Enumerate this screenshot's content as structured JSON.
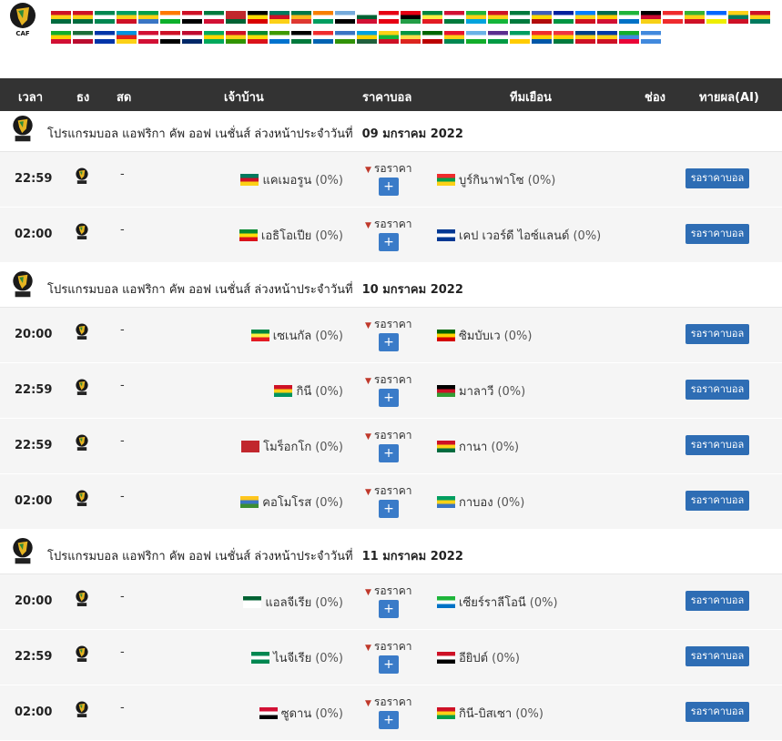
{
  "header": {
    "time": "เวลา",
    "flag": "ธง",
    "live": "สด",
    "home": "เจ้าบ้าน",
    "price": "ราคาบอล",
    "away": "ทีมเยือน",
    "channel": "ช่อง",
    "predict": "ทายผล(AI)"
  },
  "logo_text": "CAF",
  "flag_icons": [
    {
      "colors": [
        "#ce1126",
        "#fcd116",
        "#006b3f"
      ]
    },
    {
      "colors": [
        "#ce1126",
        "#fcd116",
        "#006b3f"
      ]
    },
    {
      "colors": [
        "#008751",
        "#fff",
        "#008751"
      ]
    },
    {
      "colors": [
        "#009e60",
        "#fcd116",
        "#ce1126"
      ]
    },
    {
      "colors": [
        "#009e49",
        "#fcd116",
        "#3a75c4"
      ]
    },
    {
      "colors": [
        "#ff7900",
        "#fff",
        "#0db02b"
      ]
    },
    {
      "colors": [
        "#ce1126",
        "#fff",
        "#000"
      ]
    },
    {
      "colors": [
        "#007a3d",
        "#fff",
        "#d21034"
      ]
    },
    {
      "colors": [
        "#c1272d",
        "#c1272d",
        "#006233"
      ]
    },
    {
      "colors": [
        "#000",
        "#fcdc04",
        "#d90000"
      ]
    },
    {
      "colors": [
        "#007a5e",
        "#ce1126",
        "#fcd116"
      ]
    },
    {
      "colors": [
        "#007749",
        "#ffb81c",
        "#de3831"
      ]
    },
    {
      "colors": [
        "#f77f00",
        "#fff",
        "#009e60"
      ]
    },
    {
      "colors": [
        "#75aadb",
        "#fff",
        "#000"
      ]
    },
    {
      "colors": [
        "#fff",
        "#006233",
        "#d21034"
      ]
    },
    {
      "colors": [
        "#e70013",
        "#fff",
        "#e70013"
      ]
    },
    {
      "colors": [
        "#e70013",
        "#000",
        "#239e46"
      ]
    },
    {
      "colors": [
        "#00853f",
        "#fdef42",
        "#e31b23"
      ]
    },
    {
      "colors": [
        "#d21034",
        "#fff",
        "#007a3d"
      ]
    },
    {
      "colors": [
        "#1eb53a",
        "#fcd116",
        "#00a3dd"
      ]
    },
    {
      "colors": [
        "#ce1126",
        "#fcd116",
        "#14b53a"
      ]
    },
    {
      "colors": [
        "#007a3d",
        "#fff",
        "#007a3d"
      ]
    },
    {
      "colors": [
        "#3e5eb9",
        "#ffd900",
        "#b10c0c"
      ]
    },
    {
      "colors": [
        "#00209f",
        "#fff",
        "#009543"
      ]
    },
    {
      "colors": [
        "#007fff",
        "#f7d618",
        "#ce1021"
      ]
    },
    {
      "colors": [
        "#006a4e",
        "#ffce00",
        "#d21034"
      ]
    },
    {
      "colors": [
        "#1eb53a",
        "#fff",
        "#0072c6"
      ]
    },
    {
      "colors": [
        "#000",
        "#cc092f",
        "#f7d116"
      ]
    },
    {
      "colors": [
        "#ef2b2d",
        "#fff",
        "#ef2b2d"
      ]
    },
    {
      "colors": [
        "#34b233",
        "#fcd116",
        "#ce1126"
      ]
    },
    {
      "colors": [
        "#0066ff",
        "#fff",
        "#eeee00"
      ]
    },
    {
      "colors": [
        "#fcd116",
        "#007a5e",
        "#ce1126"
      ]
    },
    {
      "colors": [
        "#ce1126",
        "#fcd116",
        "#007a5e"
      ]
    },
    {
      "colors": [
        "#12ad2b",
        "#ffd100",
        "#d21034"
      ]
    },
    {
      "colors": [
        "#1c6d38",
        "#fff",
        "#ba0c2f"
      ]
    },
    {
      "colors": [
        "#0035a9",
        "#fff",
        "#0035a9"
      ]
    },
    {
      "colors": [
        "#0093dd",
        "#e32118",
        "#fcd116"
      ]
    },
    {
      "colors": [
        "#d21034",
        "#fff",
        "#d21034"
      ]
    },
    {
      "colors": [
        "#ce1126",
        "#fff",
        "#000"
      ]
    },
    {
      "colors": [
        "#bf0a30",
        "#fff",
        "#002868"
      ]
    },
    {
      "colors": [
        "#00a95c",
        "#ffd700",
        "#00a95c"
      ]
    },
    {
      "colors": [
        "#ce1126",
        "#fcd116",
        "#319400"
      ]
    },
    {
      "colors": [
        "#078930",
        "#fcdd09",
        "#da121a"
      ]
    },
    {
      "colors": [
        "#3e9a00",
        "#fff",
        "#0073ce"
      ]
    },
    {
      "colors": [
        "#000",
        "#fff",
        "#007a3d"
      ]
    },
    {
      "colors": [
        "#ef2b2d",
        "#fff",
        "#0063b2"
      ]
    },
    {
      "colors": [
        "#3a75c4",
        "#fff",
        "#319208"
      ]
    },
    {
      "colors": [
        "#00a1de",
        "#fad201",
        "#20603d"
      ]
    },
    {
      "colors": [
        "#fcd116",
        "#14b53a",
        "#ce1126"
      ]
    },
    {
      "colors": [
        "#009543",
        "#fbde4a",
        "#dc241f"
      ]
    },
    {
      "colors": [
        "#006600",
        "#ffffff",
        "#bb0000"
      ]
    },
    {
      "colors": [
        "#e8112d",
        "#fcd116",
        "#008751"
      ]
    },
    {
      "colors": [
        "#6ab2e7",
        "#fff",
        "#12ad2b"
      ]
    },
    {
      "colors": [
        "#5b2d90",
        "#fff",
        "#009a44"
      ]
    },
    {
      "colors": [
        "#009e60",
        "#fff",
        "#ffcc00"
      ]
    },
    {
      "colors": [
        "#ef2b2d",
        "#ffd100",
        "#0057a8"
      ]
    },
    {
      "colors": [
        "#ef3340",
        "#ffd100",
        "#007a3d"
      ]
    },
    {
      "colors": [
        "#003f87",
        "#fcd116",
        "#ce1126"
      ]
    },
    {
      "colors": [
        "#0039a6",
        "#fcd116",
        "#ce1126"
      ]
    },
    {
      "colors": [
        "#12ad2b",
        "#4189dd",
        "#ea0437"
      ]
    },
    {
      "colors": [
        "#4189dd",
        "#fff",
        "#4189dd"
      ]
    }
  ],
  "sections": [
    {
      "title": "โปรแกรมบอล แอฟริกา คัพ ออฟ เนชั่นส์ ล่วงหน้าประจำวันที่",
      "date": "09  มกราคม 2022",
      "matches": [
        {
          "time": "22:59",
          "live": "-",
          "home": "แคเมอรูน",
          "home_pct": "(0%)",
          "home_flag": [
            "#007a5e",
            "#ce1126",
            "#fcd116"
          ],
          "away": "บูร์กินาฟาโซ",
          "away_pct": "(0%)",
          "away_flag": [
            "#ef2b2d",
            "#009e49",
            "#fcd116"
          ],
          "price": "รอราคา",
          "plus": "+",
          "btn": "รอราคาบอล"
        },
        {
          "time": "02:00",
          "live": "-",
          "home": "เอธิโอเปีย",
          "home_pct": "(0%)",
          "home_flag": [
            "#078930",
            "#fcdd09",
            "#da121a"
          ],
          "away": "เคป เวอร์ดี ไอซ์แลนด์",
          "away_pct": "(0%)",
          "away_flag": [
            "#003893",
            "#fff",
            "#003893"
          ],
          "price": "รอราคา",
          "plus": "+",
          "btn": "รอราคาบอล"
        }
      ]
    },
    {
      "title": "โปรแกรมบอล แอฟริกา คัพ ออฟ เนชั่นส์ ล่วงหน้าประจำวันที่",
      "date": "10  มกราคม 2022",
      "matches": [
        {
          "time": "20:00",
          "live": "-",
          "home": "เซเนกัล",
          "home_pct": "(0%)",
          "home_flag": [
            "#00853f",
            "#fdef42",
            "#e31b23"
          ],
          "away": "ซิมบับเว",
          "away_pct": "(0%)",
          "away_flag": [
            "#006400",
            "#ffd200",
            "#d40000"
          ],
          "price": "รอราคา",
          "plus": "+",
          "btn": "รอราคาบอล"
        },
        {
          "time": "22:59",
          "live": "-",
          "home": "กินี",
          "home_pct": "(0%)",
          "home_flag": [
            "#ce1126",
            "#fcd116",
            "#009460"
          ],
          "away": "มาลาวี",
          "away_pct": "(0%)",
          "away_flag": [
            "#000",
            "#ce1126",
            "#339e35"
          ],
          "price": "รอราคา",
          "plus": "+",
          "btn": "รอราคาบอล"
        },
        {
          "time": "22:59",
          "live": "-",
          "home": "โมร็อกโก",
          "home_pct": "(0%)",
          "home_flag": [
            "#c1272d",
            "#c1272d",
            "#c1272d"
          ],
          "away": "กานา",
          "away_pct": "(0%)",
          "away_flag": [
            "#ce1126",
            "#fcd116",
            "#006b3f"
          ],
          "price": "รอราคา",
          "plus": "+",
          "btn": "รอราคาบอล"
        },
        {
          "time": "02:00",
          "live": "-",
          "home": "คอโมโรส",
          "home_pct": "(0%)",
          "home_flag": [
            "#ffc61e",
            "#3a75c4",
            "#3d8e33"
          ],
          "away": "กาบอง",
          "away_pct": "(0%)",
          "away_flag": [
            "#009e60",
            "#fcd116",
            "#3a75c4"
          ],
          "price": "รอราคา",
          "plus": "+",
          "btn": "รอราคาบอล"
        }
      ]
    },
    {
      "title": "โปรแกรมบอล แอฟริกา คัพ ออฟ เนชั่นส์ ล่วงหน้าประจำวันที่",
      "date": "11  มกราคม 2022",
      "matches": [
        {
          "time": "20:00",
          "live": "-",
          "home": "แอลจีเรีย",
          "home_pct": "(0%)",
          "home_flag": [
            "#006233",
            "#fff",
            "#fff"
          ],
          "away": "เซียร์ราลีโอนี",
          "away_pct": "(0%)",
          "away_flag": [
            "#1eb53a",
            "#fff",
            "#0072c6"
          ],
          "price": "รอราคา",
          "plus": "+",
          "btn": "รอราคาบอล"
        },
        {
          "time": "22:59",
          "live": "-",
          "home": "ไนจีเรีย",
          "home_pct": "(0%)",
          "home_flag": [
            "#008751",
            "#fff",
            "#008751"
          ],
          "away": "อียิปต์",
          "away_pct": "(0%)",
          "away_flag": [
            "#ce1126",
            "#fff",
            "#000"
          ],
          "price": "รอราคา",
          "plus": "+",
          "btn": "รอราคาบอล"
        },
        {
          "time": "02:00",
          "live": "-",
          "home": "ซูดาน",
          "home_pct": "(0%)",
          "home_flag": [
            "#d21034",
            "#fff",
            "#000"
          ],
          "away": "กินี-บิสเซา",
          "away_pct": "(0%)",
          "away_flag": [
            "#ce1126",
            "#fcd116",
            "#009e49"
          ],
          "price": "รอราคา",
          "plus": "+",
          "btn": "รอราคาบอล"
        }
      ]
    }
  ]
}
